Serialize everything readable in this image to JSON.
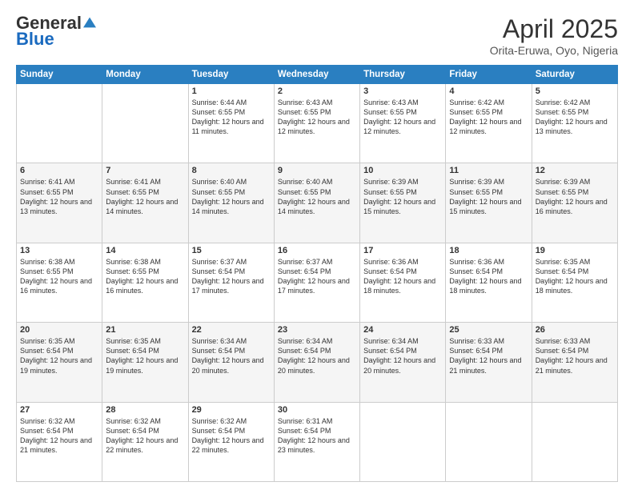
{
  "logo": {
    "general": "General",
    "blue": "Blue"
  },
  "title": {
    "month": "April 2025",
    "location": "Orita-Eruwa, Oyo, Nigeria"
  },
  "headers": [
    "Sunday",
    "Monday",
    "Tuesday",
    "Wednesday",
    "Thursday",
    "Friday",
    "Saturday"
  ],
  "weeks": [
    [
      {
        "day": "",
        "info": ""
      },
      {
        "day": "",
        "info": ""
      },
      {
        "day": "1",
        "info": "Sunrise: 6:44 AM\nSunset: 6:55 PM\nDaylight: 12 hours and 11 minutes."
      },
      {
        "day": "2",
        "info": "Sunrise: 6:43 AM\nSunset: 6:55 PM\nDaylight: 12 hours and 12 minutes."
      },
      {
        "day": "3",
        "info": "Sunrise: 6:43 AM\nSunset: 6:55 PM\nDaylight: 12 hours and 12 minutes."
      },
      {
        "day": "4",
        "info": "Sunrise: 6:42 AM\nSunset: 6:55 PM\nDaylight: 12 hours and 12 minutes."
      },
      {
        "day": "5",
        "info": "Sunrise: 6:42 AM\nSunset: 6:55 PM\nDaylight: 12 hours and 13 minutes."
      }
    ],
    [
      {
        "day": "6",
        "info": "Sunrise: 6:41 AM\nSunset: 6:55 PM\nDaylight: 12 hours and 13 minutes."
      },
      {
        "day": "7",
        "info": "Sunrise: 6:41 AM\nSunset: 6:55 PM\nDaylight: 12 hours and 14 minutes."
      },
      {
        "day": "8",
        "info": "Sunrise: 6:40 AM\nSunset: 6:55 PM\nDaylight: 12 hours and 14 minutes."
      },
      {
        "day": "9",
        "info": "Sunrise: 6:40 AM\nSunset: 6:55 PM\nDaylight: 12 hours and 14 minutes."
      },
      {
        "day": "10",
        "info": "Sunrise: 6:39 AM\nSunset: 6:55 PM\nDaylight: 12 hours and 15 minutes."
      },
      {
        "day": "11",
        "info": "Sunrise: 6:39 AM\nSunset: 6:55 PM\nDaylight: 12 hours and 15 minutes."
      },
      {
        "day": "12",
        "info": "Sunrise: 6:39 AM\nSunset: 6:55 PM\nDaylight: 12 hours and 16 minutes."
      }
    ],
    [
      {
        "day": "13",
        "info": "Sunrise: 6:38 AM\nSunset: 6:55 PM\nDaylight: 12 hours and 16 minutes."
      },
      {
        "day": "14",
        "info": "Sunrise: 6:38 AM\nSunset: 6:55 PM\nDaylight: 12 hours and 16 minutes."
      },
      {
        "day": "15",
        "info": "Sunrise: 6:37 AM\nSunset: 6:54 PM\nDaylight: 12 hours and 17 minutes."
      },
      {
        "day": "16",
        "info": "Sunrise: 6:37 AM\nSunset: 6:54 PM\nDaylight: 12 hours and 17 minutes."
      },
      {
        "day": "17",
        "info": "Sunrise: 6:36 AM\nSunset: 6:54 PM\nDaylight: 12 hours and 18 minutes."
      },
      {
        "day": "18",
        "info": "Sunrise: 6:36 AM\nSunset: 6:54 PM\nDaylight: 12 hours and 18 minutes."
      },
      {
        "day": "19",
        "info": "Sunrise: 6:35 AM\nSunset: 6:54 PM\nDaylight: 12 hours and 18 minutes."
      }
    ],
    [
      {
        "day": "20",
        "info": "Sunrise: 6:35 AM\nSunset: 6:54 PM\nDaylight: 12 hours and 19 minutes."
      },
      {
        "day": "21",
        "info": "Sunrise: 6:35 AM\nSunset: 6:54 PM\nDaylight: 12 hours and 19 minutes."
      },
      {
        "day": "22",
        "info": "Sunrise: 6:34 AM\nSunset: 6:54 PM\nDaylight: 12 hours and 20 minutes."
      },
      {
        "day": "23",
        "info": "Sunrise: 6:34 AM\nSunset: 6:54 PM\nDaylight: 12 hours and 20 minutes."
      },
      {
        "day": "24",
        "info": "Sunrise: 6:34 AM\nSunset: 6:54 PM\nDaylight: 12 hours and 20 minutes."
      },
      {
        "day": "25",
        "info": "Sunrise: 6:33 AM\nSunset: 6:54 PM\nDaylight: 12 hours and 21 minutes."
      },
      {
        "day": "26",
        "info": "Sunrise: 6:33 AM\nSunset: 6:54 PM\nDaylight: 12 hours and 21 minutes."
      }
    ],
    [
      {
        "day": "27",
        "info": "Sunrise: 6:32 AM\nSunset: 6:54 PM\nDaylight: 12 hours and 21 minutes."
      },
      {
        "day": "28",
        "info": "Sunrise: 6:32 AM\nSunset: 6:54 PM\nDaylight: 12 hours and 22 minutes."
      },
      {
        "day": "29",
        "info": "Sunrise: 6:32 AM\nSunset: 6:54 PM\nDaylight: 12 hours and 22 minutes."
      },
      {
        "day": "30",
        "info": "Sunrise: 6:31 AM\nSunset: 6:54 PM\nDaylight: 12 hours and 23 minutes."
      },
      {
        "day": "",
        "info": ""
      },
      {
        "day": "",
        "info": ""
      },
      {
        "day": "",
        "info": ""
      }
    ]
  ]
}
